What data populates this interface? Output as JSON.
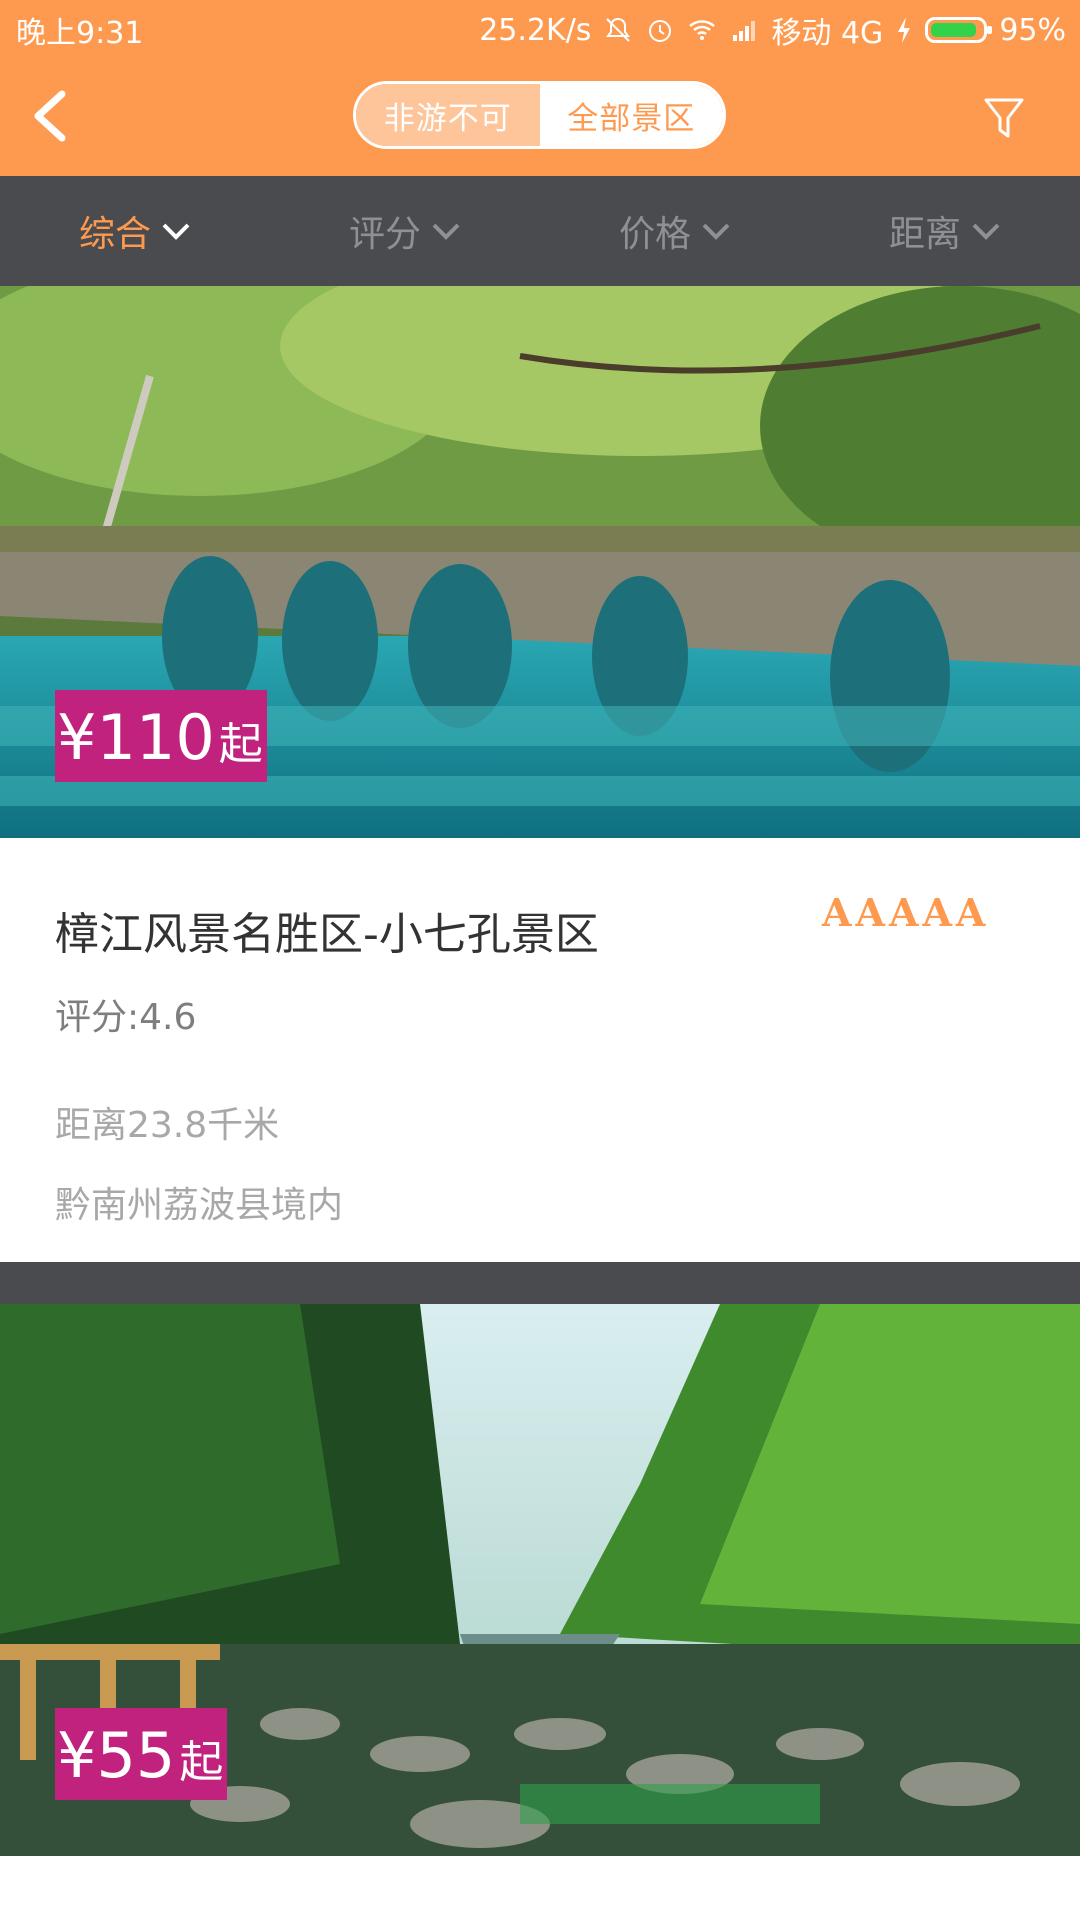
{
  "status_bar": {
    "time": "晚上9:31",
    "net_speed": "25.2K/s",
    "carrier": "移动 4G",
    "battery": "95%",
    "battery_level": 0.95,
    "icons": [
      "mute-icon",
      "alarm-icon",
      "wifi-icon",
      "signal-icon",
      "charging-icon",
      "battery-icon"
    ]
  },
  "app_bar": {
    "back_icon": "back-arrow-icon",
    "segment": {
      "left": "非游不可",
      "right": "全部景区",
      "selected": "全部景区"
    },
    "filter_icon": "filter-icon"
  },
  "sort_tabs": [
    {
      "label": "综合",
      "active": true
    },
    {
      "label": "评分",
      "active": false
    },
    {
      "label": "价格",
      "active": false
    },
    {
      "label": "距离",
      "active": false
    }
  ],
  "colors": {
    "accent": "#fe9a4f",
    "dark_bar": "#4a4b4f",
    "price_bg": "#c0227e",
    "segment_unselected": "#fec49a"
  },
  "cards": [
    {
      "price": "¥110",
      "price_suffix": "起",
      "title": "樟江风景名胜区-小七孔景区",
      "stars": "AAAAA",
      "rating": "评分:4.6",
      "distance": "距离23.8千米",
      "location": "黔南州荔波县境内",
      "image": "stone-arch-bridge-over-turquoise-river"
    },
    {
      "price": "¥55",
      "price_suffix": "起",
      "image": "forest-gorge-with-rocky-stream"
    }
  ]
}
